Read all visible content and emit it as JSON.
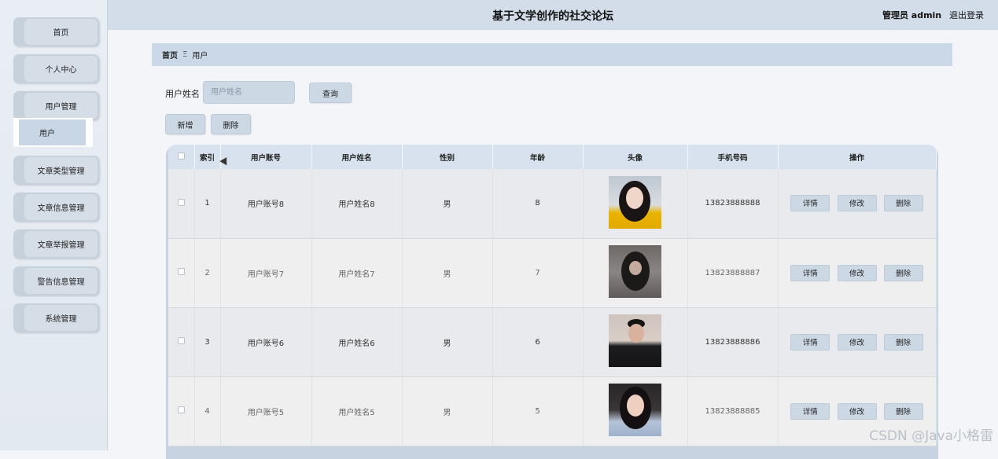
{
  "header": {
    "title": "基于文学创作的社交论坛",
    "user": "管理员 admin",
    "logout": "退出登录"
  },
  "sidebar": {
    "items": [
      {
        "label": "首页"
      },
      {
        "label": "个人中心"
      },
      {
        "label": "用户管理"
      },
      {
        "label": "文章类型管理"
      },
      {
        "label": "文章信息管理"
      },
      {
        "label": "文章举报管理"
      },
      {
        "label": "警告信息管理"
      },
      {
        "label": "系统管理"
      }
    ],
    "submenu": "用户"
  },
  "breadcrumb": {
    "home": "首页",
    "sep": "Ξ",
    "current": "用户"
  },
  "search": {
    "label": "用户姓名",
    "placeholder": "用户姓名",
    "value": "",
    "query_label": "查询"
  },
  "toolbar": {
    "add_label": "新增",
    "delete_label": "删除"
  },
  "table": {
    "headers": [
      "索引",
      "用户账号",
      "用户姓名",
      "性别",
      "年龄",
      "头像",
      "手机号码",
      "操作"
    ],
    "rows": [
      {
        "index": "1",
        "account": "用户账号8",
        "name": "用户姓名8",
        "gender": "男",
        "age": "8",
        "phone": "13823888888"
      },
      {
        "index": "2",
        "account": "用户账号7",
        "name": "用户姓名7",
        "gender": "男",
        "age": "7",
        "phone": "13823888887"
      },
      {
        "index": "3",
        "account": "用户账号6",
        "name": "用户姓名6",
        "gender": "男",
        "age": "6",
        "phone": "13823888886"
      },
      {
        "index": "4",
        "account": "用户账号5",
        "name": "用户姓名5",
        "gender": "男",
        "age": "5",
        "phone": "13823888885"
      }
    ],
    "actions": {
      "detail": "详情",
      "edit": "修改",
      "delete": "删除"
    }
  },
  "watermark": "CSDN @Java小格雷",
  "colors": {
    "accent": "#cad8e8",
    "button": "#cdd8e5"
  }
}
